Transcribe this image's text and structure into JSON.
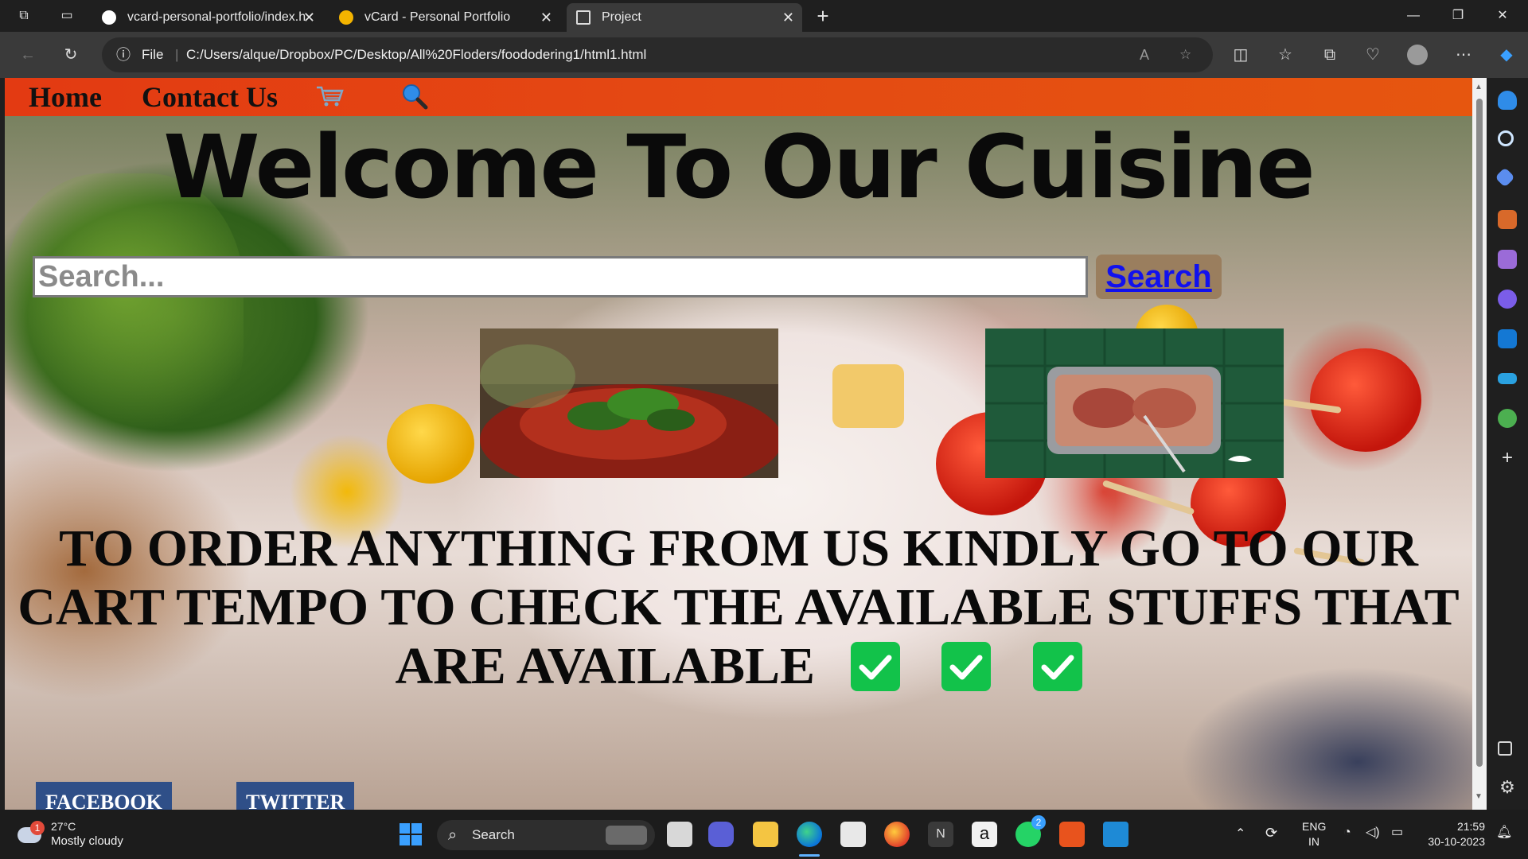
{
  "browser": {
    "tabs": [
      {
        "label": "vcard-personal-portfolio/index.h",
        "active": false
      },
      {
        "label": "vCard - Personal Portfolio",
        "active": false
      },
      {
        "label": "Project",
        "active": true
      }
    ],
    "address": {
      "scheme_label": "File",
      "url": "C:/Users/alque/Dropbox/PC/Desktop/All%20Floders/foododering1/html1.html"
    }
  },
  "page": {
    "nav": {
      "home_label": "Home",
      "contact_label": "Contact Us"
    },
    "heading": "Welcome To Our Cuisine",
    "search": {
      "placeholder": "Search...",
      "button_label": "Search"
    },
    "order_message": "TO ORDER ANYTHING FROM US KINDLY GO TO OUR CART TEMPO TO CHECK THE AVAILABLE STUFFS THAT ARE AVAILABLE",
    "social": {
      "facebook_label": "FACEBOOK",
      "twitter_label": "TWITTER"
    }
  },
  "taskbar": {
    "weather": {
      "temperature": "27°C",
      "condition": "Mostly cloudy",
      "badge": "1"
    },
    "search_label": "Search",
    "whatsapp_badge": "2",
    "language": {
      "line1": "ENG",
      "line2": "IN"
    },
    "clock": {
      "time": "21:59",
      "date": "30-10-2023"
    }
  },
  "colors": {
    "nav_bar": "#e44a13",
    "check_green": "#12c24a",
    "social_blue": "#2f4f88",
    "search_button_bg": "#9a7e5e",
    "search_link": "#1111ee"
  }
}
